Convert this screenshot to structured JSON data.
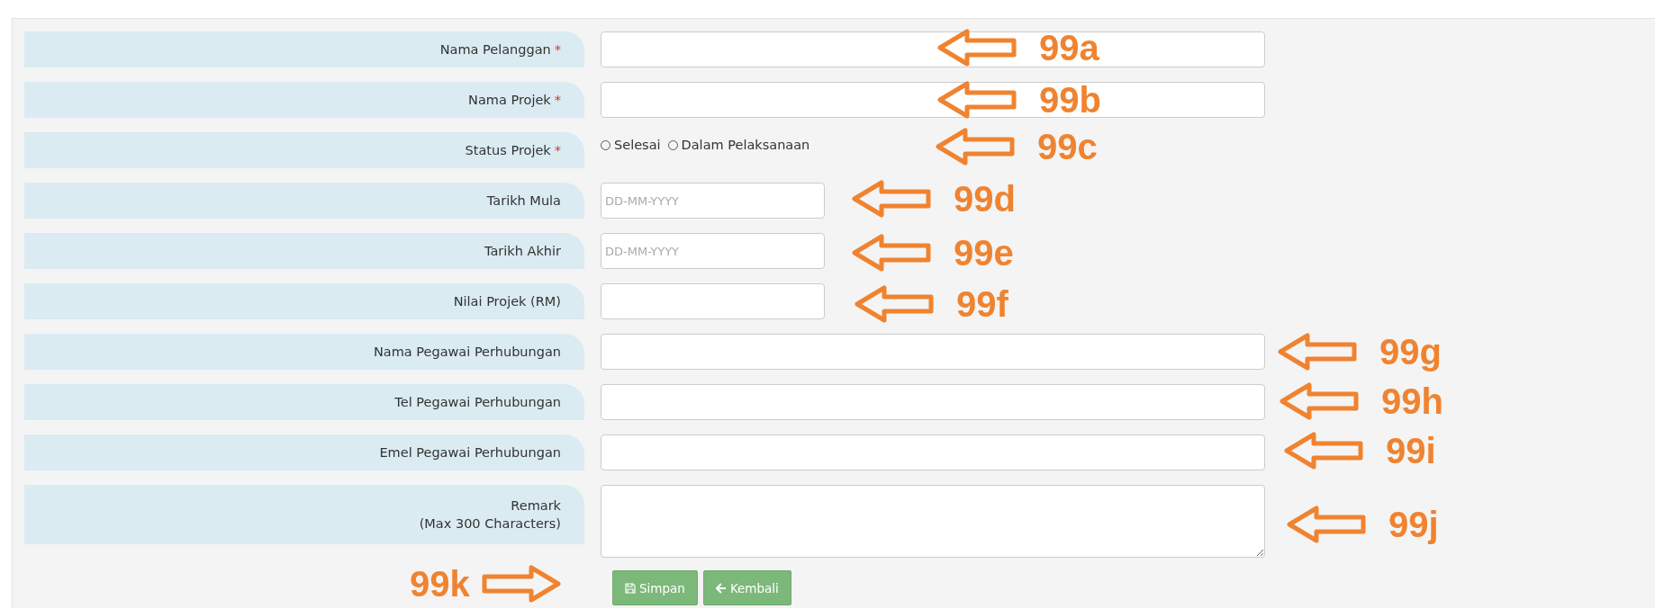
{
  "fields": [
    {
      "kind": "text",
      "label": [
        "Nama Pelanggan"
      ],
      "required_mark": "*"
    },
    {
      "kind": "text",
      "label": [
        "Nama Projek"
      ],
      "required_mark": "*"
    },
    {
      "kind": "radio",
      "label": [
        "Status Projek"
      ],
      "required_mark": "*",
      "options": [
        {
          "label": "Selesai",
          "selected": false
        },
        {
          "label": "Dalam Pelaksanaan",
          "selected": false
        }
      ]
    },
    {
      "kind": "date",
      "label": [
        "Tarikh Mula"
      ],
      "placeholder": "DD-MM-YYYY"
    },
    {
      "kind": "date",
      "label": [
        "Tarikh Akhir"
      ],
      "placeholder": "DD-MM-YYYY"
    },
    {
      "kind": "short",
      "label": [
        "Nilai Projek (RM)"
      ]
    },
    {
      "kind": "text",
      "label": [
        "Nama Pegawai Perhubungan"
      ]
    },
    {
      "kind": "text",
      "label": [
        "Tel Pegawai Perhubungan"
      ]
    },
    {
      "kind": "text",
      "label": [
        "Emel Pegawai Perhubungan"
      ]
    },
    {
      "kind": "textarea",
      "label": [
        "Remark",
        "(Max 300 Characters)"
      ]
    }
  ],
  "buttons": [
    {
      "kind": "save",
      "label": "Simpan"
    },
    {
      "kind": "back",
      "label": "Kembali"
    }
  ],
  "annotations": [
    {
      "label": "99a",
      "kind": "left"
    },
    {
      "label": "99b",
      "kind": "left"
    },
    {
      "label": "99c",
      "kind": "left"
    },
    {
      "label": "99d",
      "kind": "left"
    },
    {
      "label": "99e",
      "kind": "left"
    },
    {
      "label": "99f",
      "kind": "left"
    },
    {
      "label": "99g",
      "kind": "left"
    },
    {
      "label": "99h",
      "kind": "left"
    },
    {
      "label": "99i",
      "kind": "left"
    },
    {
      "label": "99j",
      "kind": "left"
    },
    {
      "label": "99k",
      "kind": "right"
    }
  ]
}
